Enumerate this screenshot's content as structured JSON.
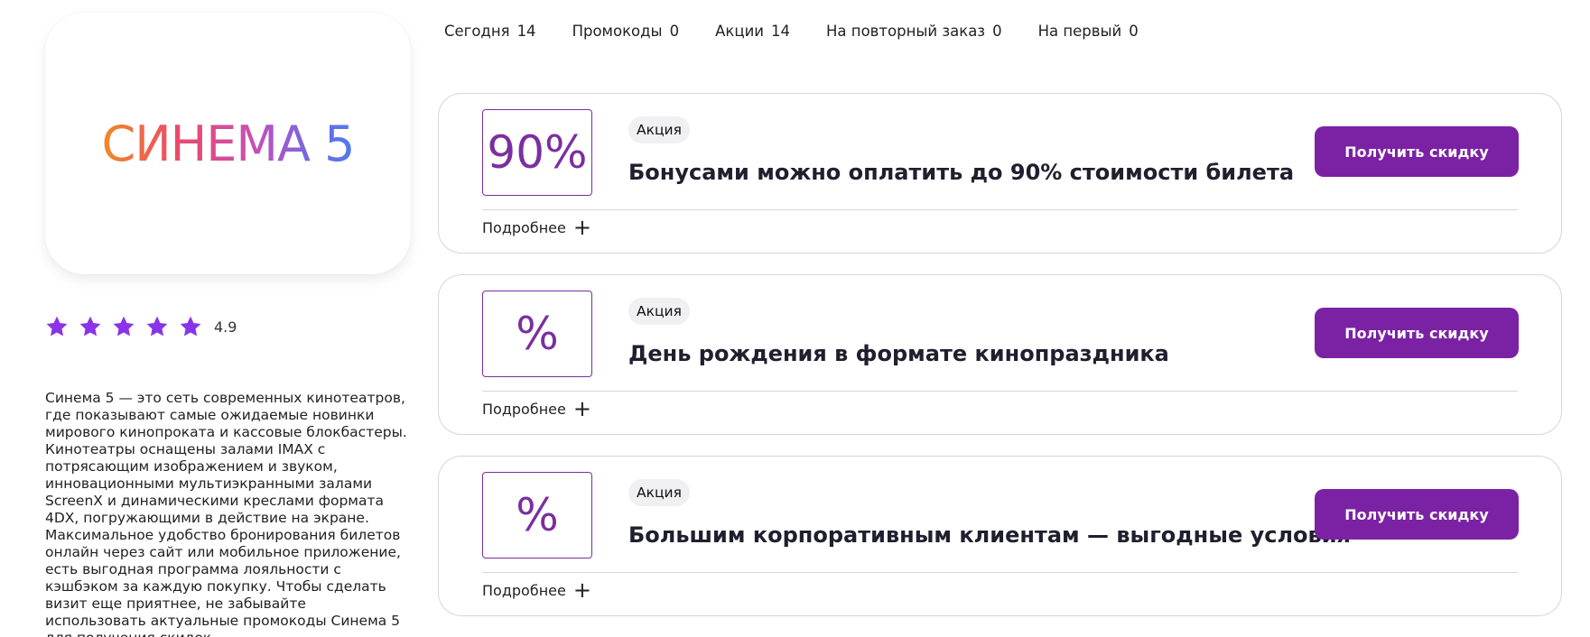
{
  "brand": {
    "name": "СИНЕМА 5",
    "rating": 4.9,
    "rating_label": "4.9",
    "star_color": "#8a33e8",
    "description": "Синема 5 — это сеть современных кинотеатров, где показывают самые ожидаемые новинки мирового кинопроката и кассовые блокбастеры. Кинотеатры оснащены залами IMAX с потрясающим изображением и звуком, инновационными мультиэкранными залами ScreenX и динамическими креслами формата 4DX, погружающими в действие на экране. Максимальное удобство бронирования билетов онлайн через сайт или мобильное приложение, есть выгодная программа лояльности с кэшбэком за каждую покупку. Чтобы сделать визит еще приятнее, не забывайте использовать актуальные промокоды Синема 5 для получения скидок."
  },
  "tabs": [
    {
      "label": "Сегодня",
      "count": "14"
    },
    {
      "label": "Промокоды",
      "count": "0"
    },
    {
      "label": "Акции",
      "count": "14"
    },
    {
      "label": "На повторный заказ",
      "count": "0"
    },
    {
      "label": "На первый",
      "count": "0"
    }
  ],
  "offers": [
    {
      "badge": "90%",
      "tag": "Акция",
      "title": "Бонусами можно оплатить до 90% стоимости билета",
      "cta": "Получить скидку",
      "more": "Подробнее"
    },
    {
      "badge": "%",
      "tag": "Акция",
      "title": "День рождения в формате кинопраздника",
      "cta": "Получить скидку",
      "more": "Подробнее"
    },
    {
      "badge": "%",
      "tag": "Акция",
      "title": "Большим корпоративным клиентам — выгодные условия",
      "cta": "Получить скидку",
      "more": "Подробнее"
    }
  ],
  "colors": {
    "accent": "#7b22a4",
    "badge_border": "#7b2ea0"
  }
}
